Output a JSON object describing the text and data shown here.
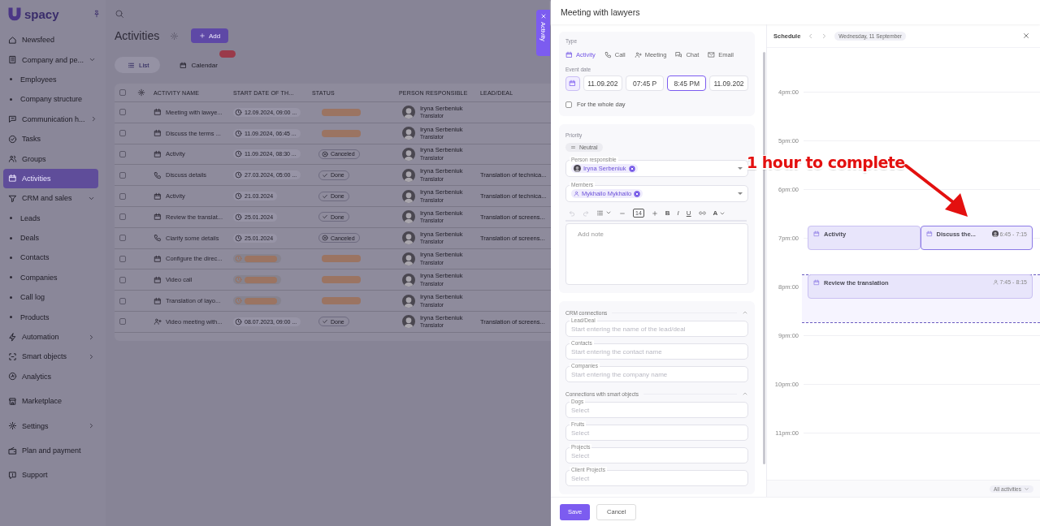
{
  "sidebar": {
    "logo": "spacy",
    "items": [
      {
        "label": "Newsfeed",
        "kind": "item",
        "selected": false
      },
      {
        "label": "Company and pe...",
        "kind": "group",
        "expanded": true,
        "selected": false
      },
      {
        "label": "Employees",
        "kind": "sub",
        "selected": false
      },
      {
        "label": "Company structure",
        "kind": "sub",
        "selected": false
      },
      {
        "label": "Communication h...",
        "kind": "group",
        "expanded": false,
        "selected": false
      },
      {
        "label": "Tasks",
        "kind": "item",
        "selected": false
      },
      {
        "label": "Groups",
        "kind": "item",
        "selected": false
      },
      {
        "label": "Activities",
        "kind": "item",
        "selected": true
      },
      {
        "label": "CRM and sales",
        "kind": "group",
        "expanded": true,
        "selected": false
      },
      {
        "label": "Leads",
        "kind": "sub",
        "selected": false
      },
      {
        "label": "Deals",
        "kind": "sub",
        "selected": false
      },
      {
        "label": "Contacts",
        "kind": "sub",
        "selected": false
      },
      {
        "label": "Companies",
        "kind": "sub",
        "selected": false
      },
      {
        "label": "Call log",
        "kind": "sub",
        "selected": false
      },
      {
        "label": "Products",
        "kind": "sub",
        "selected": false
      },
      {
        "label": "Automation",
        "kind": "group",
        "expanded": false,
        "selected": false
      },
      {
        "label": "Smart objects",
        "kind": "group",
        "expanded": false,
        "selected": false
      },
      {
        "label": "Analytics",
        "kind": "item",
        "selected": false
      },
      {
        "label": "Marketplace",
        "kind": "item",
        "selected": false
      },
      {
        "label": "Settings",
        "kind": "group",
        "expanded": false,
        "selected": false
      },
      {
        "label": "Plan and payment",
        "kind": "item",
        "selected": false
      },
      {
        "label": "Support",
        "kind": "item",
        "selected": false
      }
    ]
  },
  "page": {
    "title": "Activities",
    "add_button": "Add"
  },
  "view_tabs": [
    {
      "label": "List",
      "selected": true,
      "badge": false
    },
    {
      "label": "Calendar",
      "selected": false,
      "badge": true
    }
  ],
  "table": {
    "select_all": {
      "checked": false
    },
    "columns": [
      "ACTIVITY NAME",
      "START DATE OF TH...",
      "STATUS",
      "PERSON RESPONSIBLE",
      "LEAD/DEAL"
    ],
    "rows": [
      {
        "kind": "activity",
        "checked": false,
        "name": "Meeting with lawye...",
        "date": "12.09.2024, 09:00 ...",
        "overdue": false,
        "status": {
          "kind": "overdue"
        },
        "person": "Iryna Serbeniuk",
        "role": "Translator"
      },
      {
        "kind": "activity",
        "checked": false,
        "name": "Discuss the terms ...",
        "date": "11.09.2024, 06:45 ...",
        "overdue": false,
        "status": {
          "kind": "overdue"
        },
        "person": "Iryna Serbeniuk",
        "role": "Translator"
      },
      {
        "kind": "activity",
        "checked": false,
        "name": "Activity",
        "date": "11.09.2024, 08:30 ...",
        "overdue": false,
        "status": {
          "kind": "canceled",
          "label": "Canceled"
        },
        "person": "Iryna Serbeniuk",
        "role": "Translator"
      },
      {
        "kind": "call",
        "checked": false,
        "name": "Discuss details",
        "date": "27.03.2024, 05:00 ...",
        "overdue": false,
        "status": {
          "kind": "done",
          "label": "Done"
        },
        "person": "Iryna Serbeniuk",
        "role": "Translator",
        "lead_deal": "Translation of technica..."
      },
      {
        "kind": "activity",
        "checked": false,
        "name": "Activity",
        "date": "21.03.2024",
        "overdue": false,
        "status": {
          "kind": "done",
          "label": "Done"
        },
        "person": "Iryna Serbeniuk",
        "role": "Translator",
        "lead_deal": "Translation of technica..."
      },
      {
        "kind": "activity",
        "checked": false,
        "name": "Review the translat...",
        "date": "25.01.2024",
        "overdue": false,
        "status": {
          "kind": "done",
          "label": "Done"
        },
        "person": "Iryna Serbeniuk",
        "role": "Translator",
        "lead_deal": "Translation of screens..."
      },
      {
        "kind": "call",
        "checked": false,
        "name": "Clarify some details",
        "date": "25.01.2024",
        "overdue": false,
        "status": {
          "kind": "canceled",
          "label": "Canceled"
        },
        "person": "Iryna Serbeniuk",
        "role": "Translator",
        "lead_deal": "Translation of screens..."
      },
      {
        "kind": "activity",
        "checked": false,
        "name": "Configure the direc...",
        "overdue": true,
        "status": {
          "kind": "overdue"
        },
        "person": "Iryna Serbeniuk",
        "role": "Translator"
      },
      {
        "kind": "activity",
        "checked": false,
        "name": "Video call",
        "overdue": true,
        "status": {
          "kind": "overdue"
        },
        "person": "Iryna Serbeniuk",
        "role": "Translator"
      },
      {
        "kind": "activity",
        "checked": false,
        "name": "Translation of layo...",
        "overdue": true,
        "status": {
          "kind": "overdue"
        },
        "person": "Iryna Serbeniuk",
        "role": "Translator"
      },
      {
        "kind": "meeting",
        "checked": false,
        "name": "Video meeting with...",
        "date": "08.07.2023, 09:00 ...",
        "overdue": false,
        "status": {
          "kind": "done",
          "label": "Done"
        },
        "person": "Iryna Serbeniuk",
        "role": "Translator",
        "lead_deal": "Translation of screens..."
      }
    ]
  },
  "side_tab": {
    "label": "Activity"
  },
  "drawer": {
    "title": "Meeting with lawyers",
    "type_label": "Type",
    "types": [
      {
        "label": "Activity",
        "kind": "activity",
        "selected": true
      },
      {
        "label": "Call",
        "kind": "call",
        "selected": false
      },
      {
        "label": "Meeting",
        "kind": "meeting",
        "selected": false
      },
      {
        "label": "Chat",
        "kind": "chat",
        "selected": false
      },
      {
        "label": "Email",
        "kind": "email",
        "selected": false
      }
    ],
    "event_date_label": "Event date",
    "date_fields": [
      {
        "value": "11.09.202",
        "focused": false
      },
      {
        "value": "07:45 P",
        "focused": false
      },
      {
        "value": "8:45 PM",
        "focused": true
      },
      {
        "value": "11.09.202",
        "focused": false
      }
    ],
    "whole_day": {
      "label": "For the whole day",
      "checked": false
    },
    "priority_label": "Priority",
    "priority": "Neutral",
    "person_field": {
      "label": "Person responsible",
      "chip": "Iryna Serbeniuk",
      "kind": "photo"
    },
    "members_field": {
      "label": "Members",
      "chip": "Mykhailo Mykhailo",
      "kind": "person"
    },
    "editor": {
      "font_size": "14",
      "format_buttons": [
        {
          "label": "B",
          "kind": "bold"
        },
        {
          "label": "I",
          "kind": "italic"
        },
        {
          "label": "U",
          "kind": "underline"
        }
      ],
      "color_button": "A",
      "placeholder": "Add note"
    },
    "sections": [
      {
        "title": "CRM connections",
        "expanded": true,
        "fields": [
          {
            "label": "Lead/Deal",
            "placeholder": "Start entering the name of the lead/deal"
          },
          {
            "label": "Contacts",
            "placeholder": "Start entering the contact name"
          },
          {
            "label": "Companies",
            "placeholder": "Start entering the company name"
          }
        ]
      },
      {
        "title": "Connections with smart objects",
        "expanded": true,
        "fields": [
          {
            "label": "Dogs",
            "placeholder": "Select"
          },
          {
            "label": "Fruits",
            "placeholder": "Select"
          },
          {
            "label": "Projects",
            "placeholder": "Select"
          },
          {
            "label": "Client Projects",
            "placeholder": "Select"
          }
        ]
      }
    ],
    "buttons": {
      "save": "Save",
      "cancel": "Cancel"
    }
  },
  "schedule": {
    "title": "Schedule",
    "date": "Wednesday, 11 September",
    "hours": [
      {
        "label": "4pm:00",
        "selected": false
      },
      {
        "label": "5pm:00",
        "selected": false
      },
      {
        "label": "6pm:00",
        "selected": false
      },
      {
        "label": "7pm:00",
        "selected": false,
        "events": [
          {
            "title": "Activity",
            "kind": "plain",
            "selected": false
          },
          {
            "title": "Discuss the...",
            "kind": "photo",
            "selected": true,
            "time": "6:45 - 7:15"
          }
        ]
      },
      {
        "label": "8pm:00",
        "selected": true,
        "events": [
          {
            "title": "Review the translation",
            "kind": "person",
            "selected": false,
            "time": "7:45 - 8:15"
          }
        ]
      },
      {
        "label": "9pm:00",
        "selected": false
      },
      {
        "label": "10pm:00",
        "selected": false
      },
      {
        "label": "11pm:00",
        "selected": false
      }
    ],
    "filter": "All activities"
  },
  "annotation": {
    "text": "1 hour to complete"
  }
}
